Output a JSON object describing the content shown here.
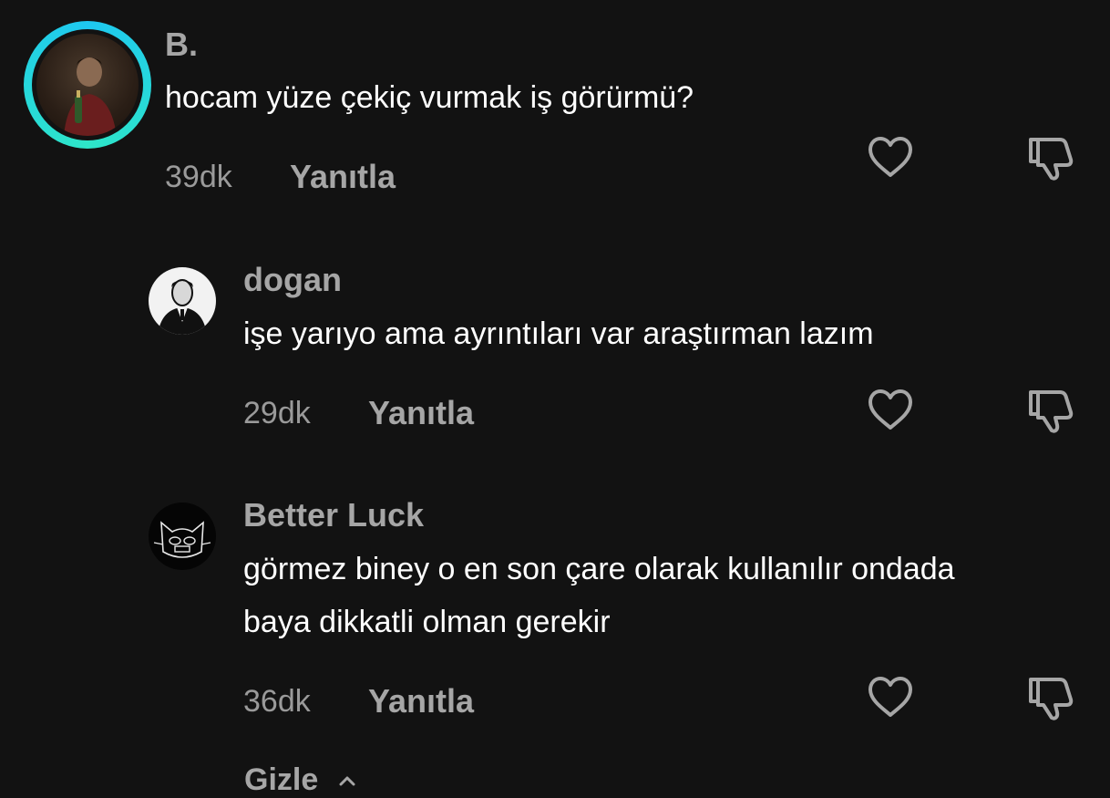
{
  "comments": [
    {
      "username": "B.",
      "text_lines": [
        "hocam yüze çekiç vurmak iş görürmü?"
      ],
      "time": "39dk",
      "reply_label": "Yanıtla",
      "has_story_ring": true
    },
    {
      "username": "dogan",
      "text_lines": [
        "işe yarıyo ama ayrıntıları var araştırman lazım"
      ],
      "time": "29dk",
      "reply_label": "Yanıtla",
      "has_story_ring": false
    },
    {
      "username": "Better Luck",
      "text_lines": [
        "görmez biney o en son çare olarak kullanılır ondada",
        "baya dikkatli olman gerekir"
      ],
      "time": "36dk",
      "reply_label": "Yanıtla",
      "has_story_ring": false
    }
  ],
  "footer": {
    "hide_label": "Gizle"
  },
  "colors": {
    "background": "#121212",
    "username": "#a6a6a6",
    "text": "#ffffff",
    "meta": "#9a9a9a",
    "story_ring_start": "#1ec8f0",
    "story_ring_end": "#2ee6c8"
  },
  "icons": [
    "like-heart-icon",
    "dislike-thumb-icon",
    "chevron-up-icon"
  ]
}
